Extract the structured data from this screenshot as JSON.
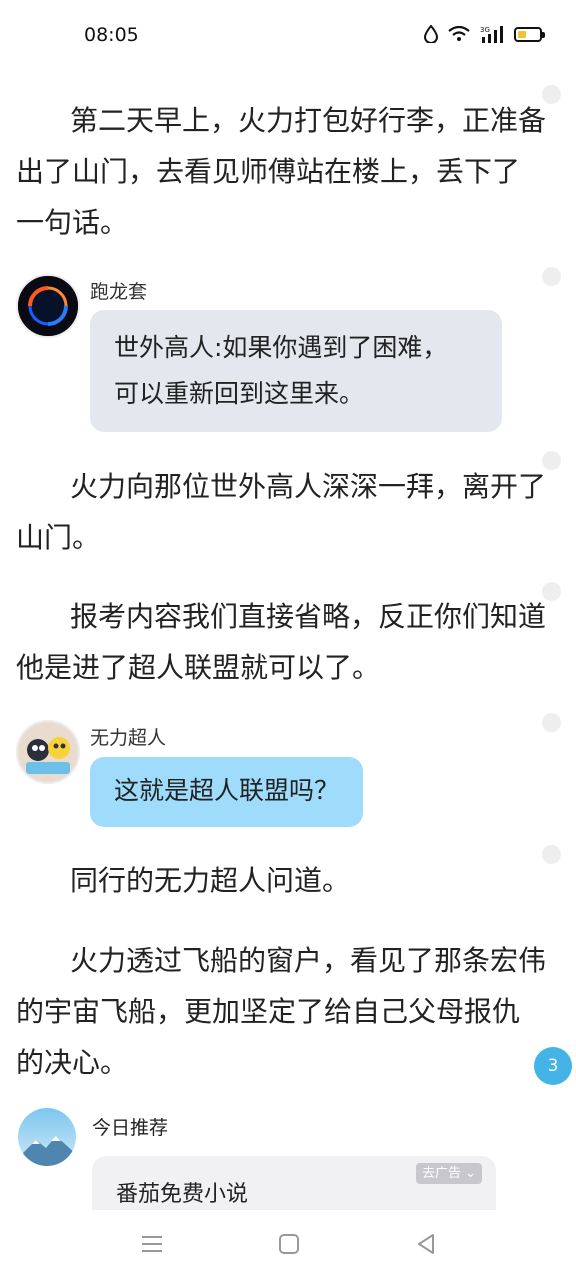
{
  "status_bar": {
    "time": "08:05"
  },
  "story": {
    "para1": "第二天早上，火力打包好行李，正准备出了山门，去看见师傅站在楼上，丢下了一句话。",
    "para2": "火力向那位世外高人深深一拜，离开了山门。",
    "para3": "报考内容我们直接省略，反正你们知道他是进了超人联盟就可以了。",
    "para4": "同行的无力超人问道。",
    "para5": "火力透过飞船的窗户，看见了那条宏伟的宇宙飞船，更加坚定了给自己父母报仇的决心。"
  },
  "chat": {
    "msg1": {
      "speaker": "跑龙套",
      "line1": "世外高人:如果你遇到了困难，",
      "line2": "可以重新回到这里来。"
    },
    "msg2": {
      "speaker": "无力超人",
      "text": "这就是超人联盟吗？"
    }
  },
  "float_badge": {
    "count": "3"
  },
  "recommend": {
    "title": "今日推荐",
    "book": "番茄免费小说",
    "ad_label": "去广告"
  },
  "colors": {
    "bubble_gray": "#e4e8ee",
    "bubble_blue": "#9fdcfb",
    "badge": "#44b3e6"
  }
}
